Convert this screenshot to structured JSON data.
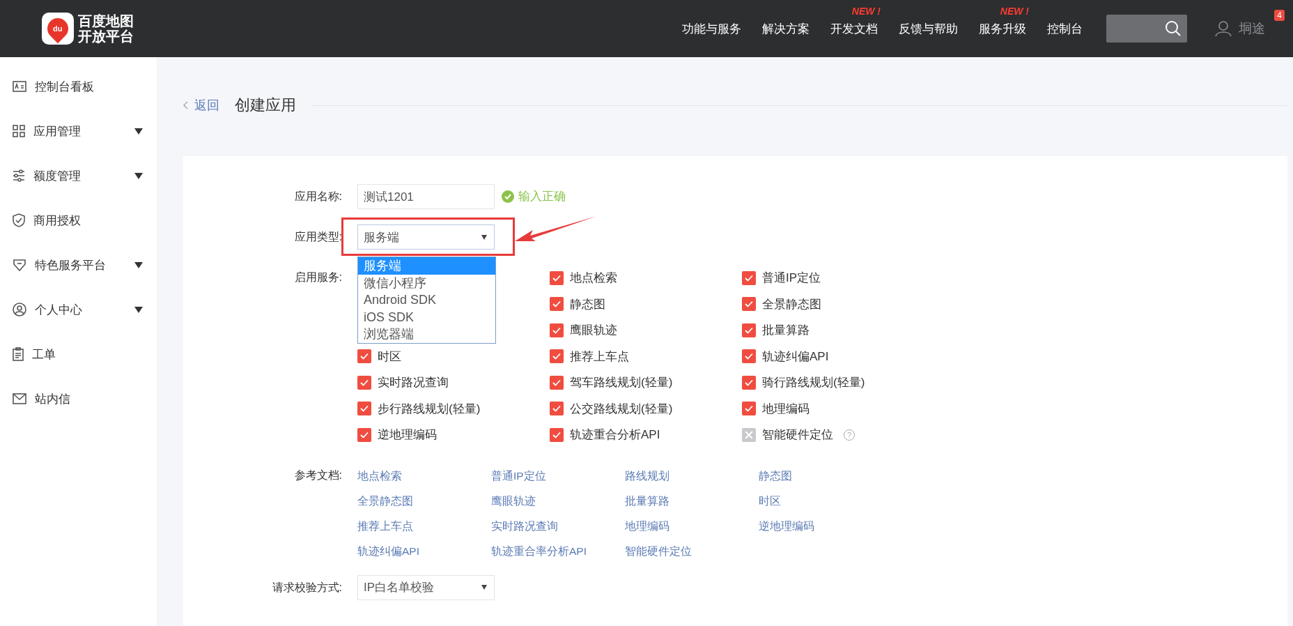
{
  "header": {
    "logo": {
      "badge": "du",
      "line_1": "百度地图",
      "line_2": "开放平台"
    },
    "nav": [
      {
        "label": "功能与服务"
      },
      {
        "label": "解决方案"
      },
      {
        "label": "开发文档",
        "tag": "NEW !"
      },
      {
        "label": "反馈与帮助"
      },
      {
        "label": "服务升级",
        "tag": "NEW !"
      },
      {
        "label": "控制台"
      }
    ],
    "user": {
      "name": "垌途",
      "badge": "4"
    }
  },
  "sidebar": {
    "items": [
      {
        "label": "控制台看板",
        "expandable": false
      },
      {
        "label": "应用管理",
        "expandable": true
      },
      {
        "label": "额度管理",
        "expandable": true
      },
      {
        "label": "商用授权",
        "expandable": false
      },
      {
        "label": "特色服务平台",
        "expandable": true
      },
      {
        "label": "个人中心",
        "expandable": true
      },
      {
        "label": "工单",
        "expandable": false
      },
      {
        "label": "站内信",
        "expandable": false
      }
    ]
  },
  "page": {
    "back": "返回",
    "title": "创建应用"
  },
  "form": {
    "name": {
      "label": "应用名称:",
      "value": "测试1201",
      "status": "输入正确"
    },
    "type": {
      "label": "应用类型:",
      "value": "服务端",
      "expanded": true,
      "options": [
        {
          "label": "服务端",
          "selected": true
        },
        {
          "label": "微信小程序",
          "selected": false
        },
        {
          "label": "Android SDK",
          "selected": false
        },
        {
          "label": "iOS SDK",
          "selected": false
        },
        {
          "label": "浏览器端",
          "selected": false
        }
      ]
    },
    "services": {
      "label": "启用服务:",
      "columns": [
        [
          {
            "label": "时区",
            "checked": true
          },
          {
            "label": "实时路况查询",
            "checked": true
          },
          {
            "label": "步行路线规划(轻量)",
            "checked": true
          },
          {
            "label": "逆地理编码",
            "checked": true
          }
        ],
        [
          {
            "label": "地点检索",
            "checked": true
          },
          {
            "label": "静态图",
            "checked": true
          },
          {
            "label": "鹰眼轨迹",
            "checked": true
          },
          {
            "label": "推荐上车点",
            "checked": true
          },
          {
            "label": "驾车路线规划(轻量)",
            "checked": true
          },
          {
            "label": "公交路线规划(轻量)",
            "checked": true
          },
          {
            "label": "轨迹重合分析API",
            "checked": true
          }
        ],
        [
          {
            "label": "普通IP定位",
            "checked": true
          },
          {
            "label": "全景静态图",
            "checked": true
          },
          {
            "label": "批量算路",
            "checked": true
          },
          {
            "label": "轨迹纠偏API",
            "checked": true
          },
          {
            "label": "骑行路线规划(轻量)",
            "checked": true
          },
          {
            "label": "地理编码",
            "checked": true
          },
          {
            "label": "智能硬件定位",
            "checked": false,
            "help": "?"
          }
        ]
      ]
    },
    "docs": {
      "label": "参考文档:",
      "links": [
        "地点检索",
        "普通IP定位",
        "路线规划",
        "静态图",
        "全景静态图",
        "鹰眼轨迹",
        "批量算路",
        "时区",
        "推荐上车点",
        "实时路况查询",
        "地理编码",
        "逆地理编码",
        "轨迹纠偏API",
        "轨迹重合率分析API",
        "智能硬件定位"
      ]
    },
    "verify": {
      "label": "请求校验方式:",
      "value": "IP白名单校验"
    }
  }
}
